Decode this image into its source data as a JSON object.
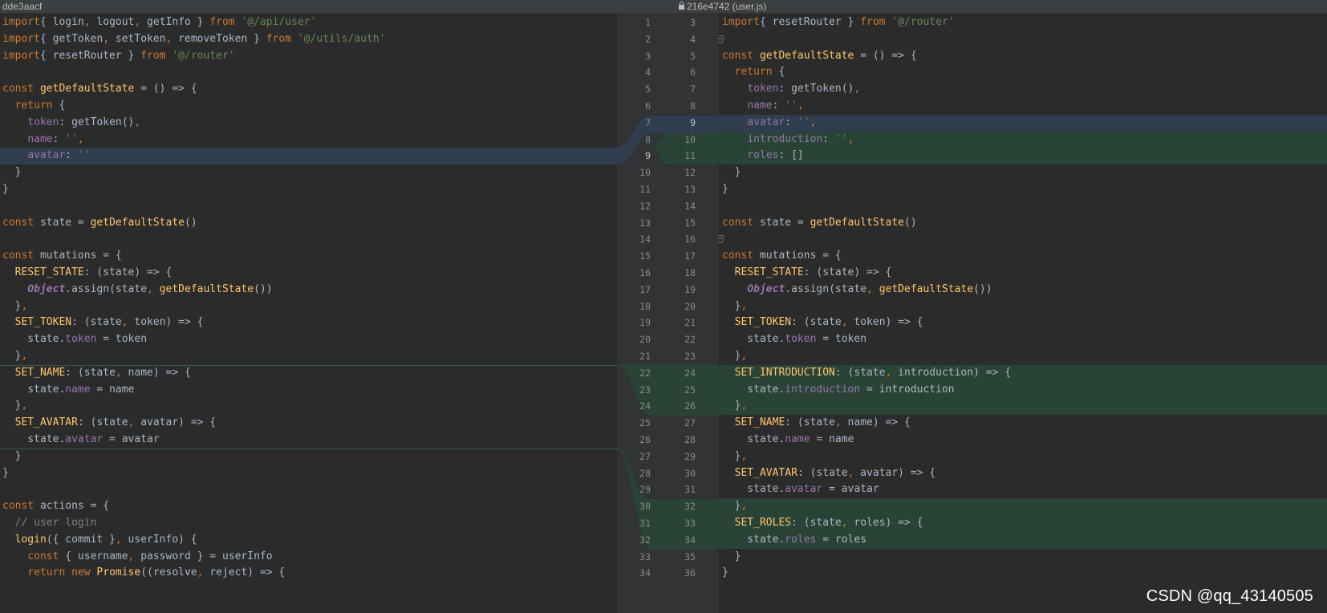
{
  "window": {
    "left_revision": "dde3aacf",
    "right_revision": "216e4742 (user.js)"
  },
  "watermark": "CSDN @qq_43140505",
  "colors": {
    "background": "#2b2b2b",
    "gutter": "#313335",
    "modified_highlight": "#2f3d4e",
    "inserted_highlight": "#294436",
    "keyword": "#cc7832",
    "string": "#6a8759",
    "function": "#ffc66d",
    "property": "#9876aa",
    "comment": "#808080"
  },
  "left_lines": [
    {
      "num": "1",
      "hl": "",
      "tokens": [
        [
          "kw",
          "import"
        ],
        [
          "",
          "{ login"
        ],
        [
          "kw",
          ","
        ],
        [
          "",
          " logout"
        ],
        [
          "kw",
          ","
        ],
        [
          "",
          " getInfo } "
        ],
        [
          "kw",
          "from"
        ],
        [
          "",
          " "
        ],
        [
          "str",
          "'@/api/user'"
        ]
      ]
    },
    {
      "num": "2",
      "hl": "",
      "tokens": [
        [
          "kw",
          "import"
        ],
        [
          "",
          "{ getToken"
        ],
        [
          "kw",
          ","
        ],
        [
          "",
          " setToken"
        ],
        [
          "kw",
          ","
        ],
        [
          "",
          " removeToken } "
        ],
        [
          "kw",
          "from"
        ],
        [
          "",
          " "
        ],
        [
          "str",
          "'@/utils/auth'"
        ]
      ]
    },
    {
      "num": "3",
      "hl": "",
      "tokens": [
        [
          "kw",
          "import"
        ],
        [
          "",
          "{ resetRouter } "
        ],
        [
          "kw",
          "from"
        ],
        [
          "",
          " "
        ],
        [
          "str",
          "'@/router'"
        ]
      ]
    },
    {
      "num": "4",
      "hl": "",
      "tokens": []
    },
    {
      "num": "5",
      "hl": "",
      "tokens": [
        [
          "kw",
          "const"
        ],
        [
          "",
          " "
        ],
        [
          "fn",
          "getDefaultState"
        ],
        [
          "",
          " = () => {"
        ]
      ]
    },
    {
      "num": "6",
      "hl": "",
      "tokens": [
        [
          "",
          "  "
        ],
        [
          "kw",
          "return"
        ],
        [
          "",
          " {"
        ]
      ]
    },
    {
      "num": "7",
      "hl": "",
      "tokens": [
        [
          "",
          "    "
        ],
        [
          "prop",
          "token"
        ],
        [
          "",
          ": getToken()"
        ],
        [
          "kw",
          ","
        ]
      ]
    },
    {
      "num": "8",
      "hl": "",
      "tokens": [
        [
          "",
          "    "
        ],
        [
          "prop",
          "name"
        ],
        [
          "",
          ": "
        ],
        [
          "str",
          "''"
        ],
        [
          "kw",
          ","
        ]
      ]
    },
    {
      "num": "9",
      "hl": "blue",
      "tokens": [
        [
          "",
          "    "
        ],
        [
          "prop",
          "avatar"
        ],
        [
          "",
          ": "
        ],
        [
          "str",
          "''"
        ]
      ]
    },
    {
      "num": "10",
      "hl": "",
      "tokens": [
        [
          "",
          "  }"
        ]
      ]
    },
    {
      "num": "11",
      "hl": "",
      "tokens": [
        [
          "",
          "}"
        ]
      ]
    },
    {
      "num": "12",
      "hl": "",
      "tokens": []
    },
    {
      "num": "13",
      "hl": "",
      "tokens": [
        [
          "kw",
          "const"
        ],
        [
          "",
          " state = "
        ],
        [
          "fn",
          "getDefaultState"
        ],
        [
          "",
          "()"
        ]
      ]
    },
    {
      "num": "14",
      "hl": "",
      "tokens": []
    },
    {
      "num": "15",
      "hl": "",
      "tokens": [
        [
          "kw",
          "const"
        ],
        [
          "",
          " mutations = {"
        ]
      ]
    },
    {
      "num": "16",
      "hl": "",
      "tokens": [
        [
          "",
          "  "
        ],
        [
          "key",
          "RESET_STATE"
        ],
        [
          "",
          ": (state) => {"
        ]
      ]
    },
    {
      "num": "17",
      "hl": "",
      "tokens": [
        [
          "",
          "    "
        ],
        [
          "obj",
          "Object"
        ],
        [
          "",
          ".assign(state"
        ],
        [
          "kw",
          ","
        ],
        [
          "",
          " "
        ],
        [
          "fn",
          "getDefaultState"
        ],
        [
          "",
          "())"
        ]
      ]
    },
    {
      "num": "18",
      "hl": "",
      "tokens": [
        [
          "",
          "  }"
        ],
        [
          "kw",
          ","
        ]
      ]
    },
    {
      "num": "19",
      "hl": "",
      "tokens": [
        [
          "",
          "  "
        ],
        [
          "key",
          "SET_TOKEN"
        ],
        [
          "",
          ": (state"
        ],
        [
          "kw",
          ","
        ],
        [
          "",
          " token) => {"
        ]
      ]
    },
    {
      "num": "20",
      "hl": "",
      "tokens": [
        [
          "",
          "    state."
        ],
        [
          "prop",
          "token"
        ],
        [
          "",
          " = token"
        ]
      ]
    },
    {
      "num": "21",
      "hl": "",
      "tokens": [
        [
          "",
          "  }"
        ],
        [
          "kw",
          ","
        ]
      ]
    },
    {
      "num": "22",
      "hl": "",
      "tokens": [
        [
          "",
          "  "
        ],
        [
          "key",
          "SET_NAME"
        ],
        [
          "",
          ": (state"
        ],
        [
          "kw",
          ","
        ],
        [
          "",
          " name) => {"
        ]
      ]
    },
    {
      "num": "23",
      "hl": "",
      "tokens": [
        [
          "",
          "    state."
        ],
        [
          "prop",
          "name"
        ],
        [
          "",
          " = name"
        ]
      ]
    },
    {
      "num": "24",
      "hl": "",
      "tokens": [
        [
          "",
          "  }"
        ],
        [
          "kw",
          ","
        ]
      ]
    },
    {
      "num": "25",
      "hl": "",
      "tokens": [
        [
          "",
          "  "
        ],
        [
          "key",
          "SET_AVATAR"
        ],
        [
          "",
          ": (state"
        ],
        [
          "kw",
          ","
        ],
        [
          "",
          " avatar) => {"
        ]
      ]
    },
    {
      "num": "26",
      "hl": "",
      "tokens": [
        [
          "",
          "    state."
        ],
        [
          "prop",
          "avatar"
        ],
        [
          "",
          " = avatar"
        ]
      ]
    },
    {
      "num": "27",
      "hl": "",
      "tokens": [
        [
          "",
          "  }"
        ]
      ]
    },
    {
      "num": "28",
      "hl": "",
      "tokens": [
        [
          "",
          "}"
        ]
      ]
    },
    {
      "num": "29",
      "hl": "",
      "tokens": []
    },
    {
      "num": "30",
      "hl": "",
      "tokens": [
        [
          "kw",
          "const"
        ],
        [
          "",
          " actions = {"
        ]
      ]
    },
    {
      "num": "31",
      "hl": "",
      "tokens": [
        [
          "",
          "  "
        ],
        [
          "cm",
          "// user login"
        ]
      ]
    },
    {
      "num": "32",
      "hl": "",
      "tokens": [
        [
          "",
          "  "
        ],
        [
          "fn",
          "login"
        ],
        [
          "",
          "({ commit }"
        ],
        [
          "kw",
          ","
        ],
        [
          "",
          " userInfo) {"
        ]
      ]
    },
    {
      "num": "33",
      "hl": "",
      "tokens": [
        [
          "",
          "    "
        ],
        [
          "kw",
          "const"
        ],
        [
          "",
          " { username"
        ],
        [
          "kw",
          ","
        ],
        [
          "",
          " password } = userInfo"
        ]
      ]
    },
    {
      "num": "34",
      "hl": "",
      "tokens": [
        [
          "",
          "    "
        ],
        [
          "kw",
          "return new"
        ],
        [
          "",
          " "
        ],
        [
          "fn",
          "Promise"
        ],
        [
          "",
          "((resolve"
        ],
        [
          "kw",
          ","
        ],
        [
          "",
          " reject) => {"
        ]
      ]
    }
  ],
  "right_lines": [
    {
      "num": "3",
      "hl": "",
      "tokens": [
        [
          "kw",
          "import"
        ],
        [
          "",
          "{ resetRouter } "
        ],
        [
          "kw",
          "from"
        ],
        [
          "",
          " "
        ],
        [
          "str",
          "'@/router'"
        ]
      ]
    },
    {
      "num": "4",
      "hl": "",
      "tokens": []
    },
    {
      "num": "5",
      "hl": "",
      "tokens": [
        [
          "kw",
          "const"
        ],
        [
          "",
          " "
        ],
        [
          "fn",
          "getDefaultState"
        ],
        [
          "",
          " = () => {"
        ]
      ]
    },
    {
      "num": "6",
      "hl": "",
      "tokens": [
        [
          "",
          "  "
        ],
        [
          "kw",
          "return"
        ],
        [
          "",
          " {"
        ]
      ]
    },
    {
      "num": "7",
      "hl": "",
      "tokens": [
        [
          "",
          "    "
        ],
        [
          "prop",
          "token"
        ],
        [
          "",
          ": getToken()"
        ],
        [
          "kw",
          ","
        ]
      ]
    },
    {
      "num": "8",
      "hl": "",
      "tokens": [
        [
          "",
          "    "
        ],
        [
          "prop",
          "name"
        ],
        [
          "",
          ": "
        ],
        [
          "str",
          "''"
        ],
        [
          "kw",
          ","
        ]
      ]
    },
    {
      "num": "9",
      "hl": "blue",
      "tokens": [
        [
          "",
          "    "
        ],
        [
          "prop",
          "avatar"
        ],
        [
          "",
          ": "
        ],
        [
          "str",
          "''"
        ],
        [
          "kw",
          ","
        ]
      ]
    },
    {
      "num": "10",
      "hl": "green",
      "tokens": [
        [
          "",
          "    "
        ],
        [
          "prop",
          "introduction"
        ],
        [
          "",
          ": "
        ],
        [
          "str",
          "''"
        ],
        [
          "kw",
          ","
        ]
      ]
    },
    {
      "num": "11",
      "hl": "green",
      "tokens": [
        [
          "",
          "    "
        ],
        [
          "prop",
          "roles"
        ],
        [
          "",
          ": []"
        ]
      ]
    },
    {
      "num": "12",
      "hl": "",
      "tokens": [
        [
          "",
          "  }"
        ]
      ]
    },
    {
      "num": "13",
      "hl": "",
      "tokens": [
        [
          "",
          "}"
        ]
      ]
    },
    {
      "num": "14",
      "hl": "",
      "tokens": []
    },
    {
      "num": "15",
      "hl": "",
      "tokens": [
        [
          "kw",
          "const"
        ],
        [
          "",
          " state = "
        ],
        [
          "fn",
          "getDefaultState"
        ],
        [
          "",
          "()"
        ]
      ]
    },
    {
      "num": "16",
      "hl": "",
      "tokens": []
    },
    {
      "num": "17",
      "hl": "",
      "tokens": [
        [
          "kw",
          "const"
        ],
        [
          "",
          " mutations = {"
        ]
      ]
    },
    {
      "num": "18",
      "hl": "",
      "tokens": [
        [
          "",
          "  "
        ],
        [
          "key",
          "RESET_STATE"
        ],
        [
          "",
          ": (state) => {"
        ]
      ]
    },
    {
      "num": "19",
      "hl": "",
      "tokens": [
        [
          "",
          "    "
        ],
        [
          "obj",
          "Object"
        ],
        [
          "",
          ".assign(state"
        ],
        [
          "kw",
          ","
        ],
        [
          "",
          " "
        ],
        [
          "fn",
          "getDefaultState"
        ],
        [
          "",
          "())"
        ]
      ]
    },
    {
      "num": "20",
      "hl": "",
      "tokens": [
        [
          "",
          "  }"
        ],
        [
          "kw",
          ","
        ]
      ]
    },
    {
      "num": "21",
      "hl": "",
      "tokens": [
        [
          "",
          "  "
        ],
        [
          "key",
          "SET_TOKEN"
        ],
        [
          "",
          ": (state"
        ],
        [
          "kw",
          ","
        ],
        [
          "",
          " token) => {"
        ]
      ]
    },
    {
      "num": "22",
      "hl": "",
      "tokens": [
        [
          "",
          "    state."
        ],
        [
          "prop",
          "token"
        ],
        [
          "",
          " = token"
        ]
      ]
    },
    {
      "num": "23",
      "hl": "",
      "tokens": [
        [
          "",
          "  }"
        ],
        [
          "kw",
          ","
        ]
      ]
    },
    {
      "num": "24",
      "hl": "green",
      "tokens": [
        [
          "",
          "  "
        ],
        [
          "key",
          "SET_INTRODUCTION"
        ],
        [
          "",
          ": (state"
        ],
        [
          "kw",
          ","
        ],
        [
          "",
          " introduction) => {"
        ]
      ]
    },
    {
      "num": "25",
      "hl": "green",
      "tokens": [
        [
          "",
          "    state."
        ],
        [
          "prop",
          "introduction"
        ],
        [
          "",
          " = introduction"
        ]
      ]
    },
    {
      "num": "26",
      "hl": "green",
      "tokens": [
        [
          "",
          "  }"
        ],
        [
          "kw",
          ","
        ]
      ]
    },
    {
      "num": "27",
      "hl": "",
      "tokens": [
        [
          "",
          "  "
        ],
        [
          "key",
          "SET_NAME"
        ],
        [
          "",
          ": (state"
        ],
        [
          "kw",
          ","
        ],
        [
          "",
          " name) => {"
        ]
      ]
    },
    {
      "num": "28",
      "hl": "",
      "tokens": [
        [
          "",
          "    state."
        ],
        [
          "prop",
          "name"
        ],
        [
          "",
          " = name"
        ]
      ]
    },
    {
      "num": "29",
      "hl": "",
      "tokens": [
        [
          "",
          "  }"
        ],
        [
          "kw",
          ","
        ]
      ]
    },
    {
      "num": "30",
      "hl": "",
      "tokens": [
        [
          "",
          "  "
        ],
        [
          "key",
          "SET_AVATAR"
        ],
        [
          "",
          ": (state"
        ],
        [
          "kw",
          ","
        ],
        [
          "",
          " avatar) => {"
        ]
      ]
    },
    {
      "num": "31",
      "hl": "",
      "tokens": [
        [
          "",
          "    state."
        ],
        [
          "prop",
          "avatar"
        ],
        [
          "",
          " = avatar"
        ]
      ]
    },
    {
      "num": "32",
      "hl": "green",
      "tokens": [
        [
          "",
          "  }"
        ],
        [
          "kw",
          ","
        ]
      ]
    },
    {
      "num": "33",
      "hl": "green",
      "tokens": [
        [
          "",
          "  "
        ],
        [
          "key",
          "SET_ROLES"
        ],
        [
          "",
          ": (state"
        ],
        [
          "kw",
          ","
        ],
        [
          "",
          " roles) => {"
        ]
      ]
    },
    {
      "num": "34",
      "hl": "green",
      "tokens": [
        [
          "",
          "    state."
        ],
        [
          "prop",
          "roles"
        ],
        [
          "",
          " = roles"
        ]
      ]
    },
    {
      "num": "35",
      "hl": "",
      "tokens": [
        [
          "",
          "  }"
        ]
      ]
    },
    {
      "num": "36",
      "hl": "",
      "tokens": [
        [
          "",
          "}"
        ]
      ]
    }
  ]
}
